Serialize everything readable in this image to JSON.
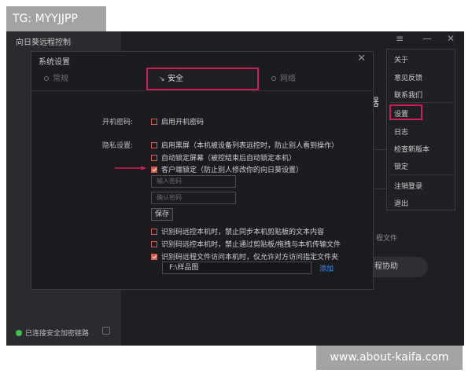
{
  "watermark_top": "TG: MYYJJPP",
  "watermark_bottom": "www.about-kaifa.com",
  "app": {
    "title": "向日葵远程控制",
    "status_text": "已连接安全加密链路",
    "bg_fragments": [
      "器",
      "程文件",
      "程协助"
    ],
    "bg_button": "程协助"
  },
  "dialog": {
    "title": "系统设置",
    "tabs": [
      {
        "label": "常规",
        "active": false
      },
      {
        "label": "安全",
        "active": true
      },
      {
        "label": "网络",
        "active": false
      }
    ],
    "boot_password_label": "开机密码:",
    "boot_password_option": "启用开机密码",
    "privacy_label": "隐私设置:",
    "privacy_options": [
      {
        "label": "启用黑屏（本机被设备列表远控时，防止别人看到操作）",
        "checked": false
      },
      {
        "label": "自动锁定屏幕（被控结束后自动锁定本机）",
        "checked": false
      },
      {
        "label": "客户端锁定（防止别人修改你的向日葵设置）",
        "checked": true
      }
    ],
    "password_placeholder": "输入密码",
    "confirm_placeholder": "确认密码",
    "save_label": "保存",
    "remote_options": [
      {
        "label": "识别码远控本机时，禁止同步本机剪贴板的文本内容",
        "checked": false
      },
      {
        "label": "识别码远控本机时，禁止通过剪贴板/拖拽与本机传输文件",
        "checked": false
      },
      {
        "label": "识别码远程文件访问本机时，仅允许对方访问指定文件夹",
        "checked": true
      }
    ],
    "folder_path": "F:\\样品图",
    "add_label": "添加"
  },
  "menu": {
    "items": [
      "关于",
      "意见反馈",
      "联系我们",
      "设置",
      "日志",
      "检查新版本",
      "锁定",
      "注销登录",
      "退出"
    ],
    "selected": "设置"
  },
  "colors": {
    "highlight": "#d11b54",
    "checkbox": "#d35b4c",
    "link": "#3a8ee6",
    "status_dot": "#3cc24a"
  }
}
